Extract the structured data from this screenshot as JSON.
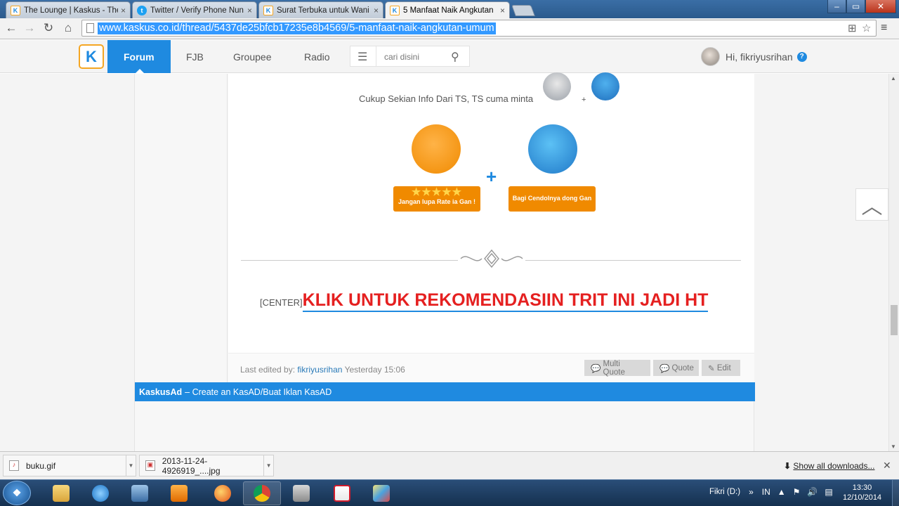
{
  "browser": {
    "tabs": [
      {
        "title": "The Lounge | Kaskus - The",
        "icon": "kaskus-favicon",
        "active": false
      },
      {
        "title": "Twitter / Verify Phone Nun",
        "icon": "twitter-favicon",
        "active": false
      },
      {
        "title": "Surat Terbuka untuk Wani",
        "icon": "kaskus-favicon",
        "active": false
      },
      {
        "title": "5 Manfaat Naik Angkutan",
        "icon": "kaskus-favicon",
        "active": true
      }
    ],
    "url": "www.kaskus.co.id/thread/5437de25bfcb17235e8b4569/5-manfaat-naik-angkutan-umum"
  },
  "site_nav": {
    "items": [
      "Forum",
      "FJB",
      "Groupee",
      "Radio"
    ],
    "active": "Forum",
    "search_placeholder": "cari disini",
    "greeting": "Hi, fikriyusrihan",
    "help": "?"
  },
  "post": {
    "closing_line": "Cukup Sekian Info Dari TS, TS cuma minta",
    "small_plus": "+",
    "big_plus": "+",
    "rate_banner": "Jangan lupa Rate ia Gan !",
    "rate_stars": "★★★★★",
    "cendol_banner": "Bagi Cendolnya dong Gan",
    "center_tag": "[CENTER]",
    "recommend_link": "KLIK UNTUK REKOMENDASIIN TRIT INI JADI HT",
    "last_edited_label": "Last edited by:",
    "last_edited_user": "fikriyusrihan",
    "last_edited_time": "Yesterday 15:06",
    "buttons": {
      "multi_quote": "Multi Quote",
      "quote": "Quote",
      "edit": "Edit"
    }
  },
  "kasad": {
    "brand": "KaskusAd",
    "text": "– Create an KasAD/Buat Iklan KasAD"
  },
  "downloads": {
    "items": [
      "buku.gif",
      "2013-11-24-4926919_....jpg"
    ],
    "show_all": "Show all downloads..."
  },
  "taskbar": {
    "drive": "Fikri (D:)",
    "lang": "IN",
    "time": "13:30",
    "date": "12/10/2014"
  },
  "colors": {
    "accent": "#1f8ae0",
    "link_red": "#e52020",
    "kaskus_orange": "#f5a623"
  }
}
